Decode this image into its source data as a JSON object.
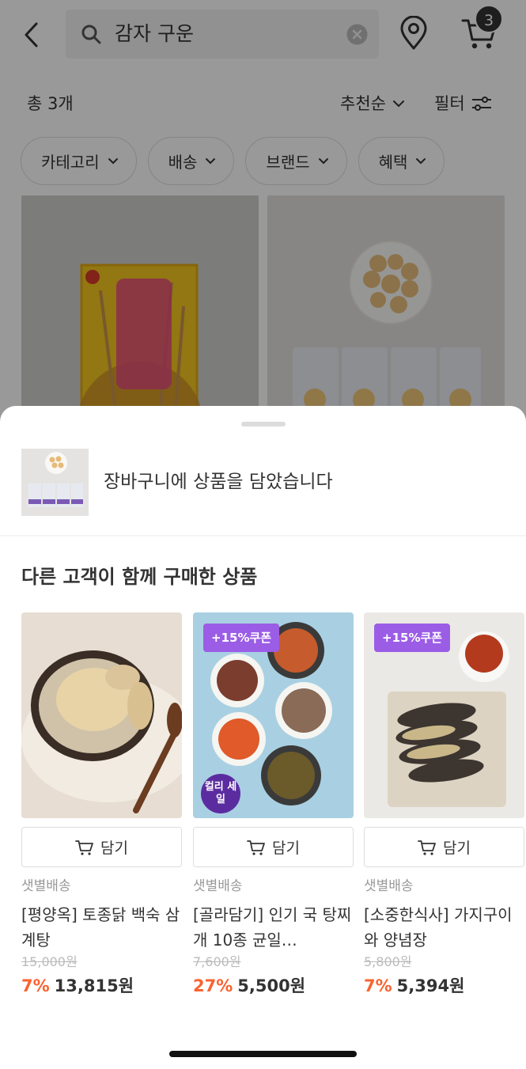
{
  "search": {
    "query": "감자 구운"
  },
  "header": {
    "cart_count": "3"
  },
  "results": {
    "count_label": "총 3개",
    "sort_label": "추천순",
    "filter_label": "필터",
    "chips": [
      "카테고리",
      "배송",
      "브랜드",
      "혜택"
    ]
  },
  "sheet": {
    "added_message": "장바구니에 상품을 담았습니다",
    "section_title": "다른 고객이 함께 구매한 상품",
    "products": [
      {
        "add_label": "담기",
        "delivery": "샛별배송",
        "name": "[평양옥] 토종닭 백숙 삼계탕",
        "original_price": "15,000원",
        "discount": "7%",
        "price": "13,815원",
        "coupon": "",
        "sale_badge": ""
      },
      {
        "add_label": "담기",
        "delivery": "샛별배송",
        "name": "[골라담기] 인기 국 탕찌개 10종 균일…",
        "original_price": "7,600원",
        "discount": "27%",
        "price": "5,500원",
        "coupon": "+15%쿠폰",
        "sale_badge": "컬리 세일"
      },
      {
        "add_label": "담기",
        "delivery": "샛별배송",
        "name": "[소중한식사] 가지구이와 양념장",
        "original_price": "5,800원",
        "discount": "7%",
        "price": "5,394원",
        "coupon": "+15%쿠폰",
        "sale_badge": ""
      }
    ]
  },
  "colors": {
    "discount": "#fa622f",
    "coupon": "#9b5de5",
    "kurly_badge": "#5b2ca0"
  }
}
